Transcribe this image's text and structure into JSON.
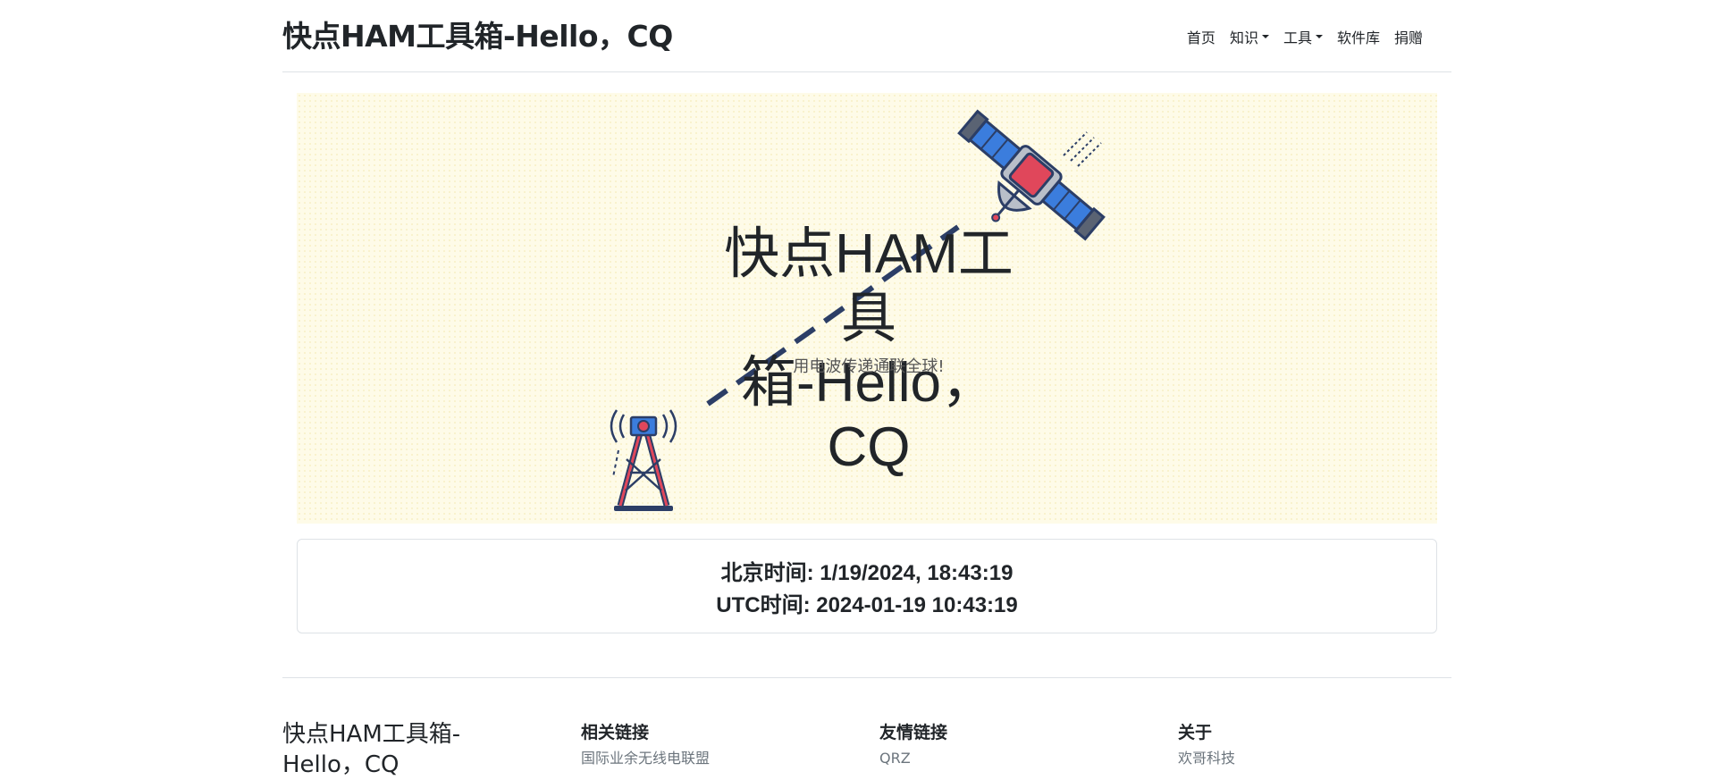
{
  "header": {
    "brand": "快点HAM工具箱-Hello，CQ",
    "nav": {
      "home": "首页",
      "knowledge": "知识",
      "tools": "工具",
      "software": "软件库",
      "donate": "捐赠"
    }
  },
  "hero": {
    "title_line1": "快点HAM工具",
    "title_line2": "箱-Hello， CQ",
    "subtitle": "用电波传递通联全球!"
  },
  "time": {
    "beijing": "北京时间: 1/19/2024, 18:43:19",
    "utc": "UTC时间: 2024-01-19 10:43:19"
  },
  "footer": {
    "brand_line1": "快点HAM工具箱-",
    "brand_line2": "Hello，CQ",
    "col1": {
      "title": "相关链接",
      "link1": "国际业余无线电联盟"
    },
    "col2": {
      "title": "友情链接",
      "link1": "QRZ"
    },
    "col3": {
      "title": "关于",
      "link1": "欢哥科技"
    }
  },
  "colors": {
    "hero_bg": "#fefbe8",
    "dash": "#2c3e66",
    "accent_red": "#e0475b",
    "accent_blue": "#3b7ddd"
  },
  "icons": [
    "radio-tower-icon",
    "satellite-icon",
    "caret-down-icon"
  ]
}
